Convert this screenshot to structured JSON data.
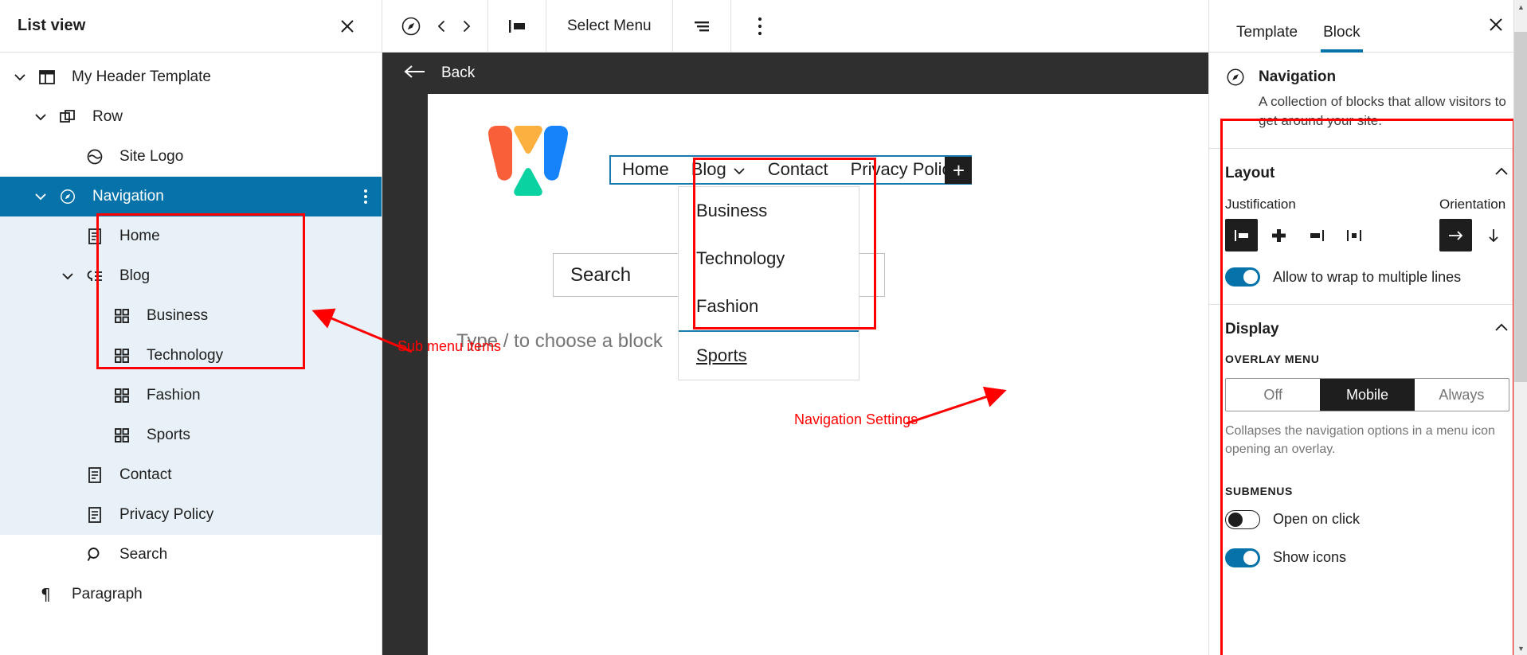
{
  "list_view": {
    "title": "List view",
    "close_icon": "close-icon",
    "items": [
      {
        "label": "My Header Template",
        "icon": "template-icon",
        "depth": 0,
        "expanded": true,
        "state": "normal"
      },
      {
        "label": "Row",
        "icon": "row-icon",
        "depth": 1,
        "expanded": true,
        "state": "normal"
      },
      {
        "label": "Site Logo",
        "icon": "site-logo-icon",
        "depth": 2,
        "expanded": null,
        "state": "normal"
      },
      {
        "label": "Navigation",
        "icon": "navigation-icon",
        "depth": 1,
        "expanded": true,
        "state": "selected"
      },
      {
        "label": "Home",
        "icon": "page-icon",
        "depth": 2,
        "expanded": null,
        "state": "child"
      },
      {
        "label": "Blog",
        "icon": "submenu-icon",
        "depth": 2,
        "expanded": true,
        "state": "child"
      },
      {
        "label": "Business",
        "icon": "grid-icon",
        "depth": 3,
        "expanded": null,
        "state": "child"
      },
      {
        "label": "Technology",
        "icon": "grid-icon",
        "depth": 3,
        "expanded": null,
        "state": "child"
      },
      {
        "label": "Fashion",
        "icon": "grid-icon",
        "depth": 3,
        "expanded": null,
        "state": "child"
      },
      {
        "label": "Sports",
        "icon": "grid-icon",
        "depth": 3,
        "expanded": null,
        "state": "child"
      },
      {
        "label": "Contact",
        "icon": "page-icon",
        "depth": 2,
        "expanded": null,
        "state": "child"
      },
      {
        "label": "Privacy Policy",
        "icon": "page-icon",
        "depth": 2,
        "expanded": null,
        "state": "child"
      },
      {
        "label": "Search",
        "icon": "search-icon",
        "depth": 2,
        "expanded": null,
        "state": "normal"
      },
      {
        "label": "Paragraph",
        "icon": "paragraph-icon",
        "depth": 0,
        "expanded": null,
        "state": "normal"
      }
    ]
  },
  "toolbar": {
    "navigation_icon": "compass-icon",
    "prev_label": "‹",
    "next_label": "›",
    "align_icon": "align-left-icon",
    "select_menu_label": "Select Menu",
    "list_icon": "justify-icon",
    "options_icon": "kebab-icon"
  },
  "canvas": {
    "back_label": "Back",
    "back_icon": "arrow-left-icon",
    "logo_alt": "site-logo",
    "nav": {
      "items": [
        {
          "label": "Home",
          "has_submenu": false
        },
        {
          "label": "Blog",
          "has_submenu": true
        },
        {
          "label": "Contact",
          "has_submenu": false
        },
        {
          "label": "Privacy Policy",
          "has_submenu": false
        }
      ],
      "add_block_label": "+"
    },
    "submenu": {
      "items": [
        {
          "label": "Business",
          "selected": false
        },
        {
          "label": "Technology",
          "selected": false
        },
        {
          "label": "Fashion",
          "selected": false
        },
        {
          "label": "Sports",
          "selected": true
        }
      ]
    },
    "search_label": "Search",
    "paragraph_placeholder": "Type / to choose a block"
  },
  "annotations": [
    {
      "label": "Sub menu items"
    },
    {
      "label": "Navigation Settings"
    }
  ],
  "settings": {
    "tabs": [
      {
        "label": "Template",
        "active": false
      },
      {
        "label": "Block",
        "active": true
      }
    ],
    "close_icon": "close-icon",
    "block": {
      "icon": "navigation-icon",
      "title": "Navigation",
      "description": "A collection of blocks that allow visitors to get around your site."
    },
    "layout": {
      "title": "Layout",
      "collapse_icon": "chevron-up-icon",
      "justification_label": "Justification",
      "orientation_label": "Orientation",
      "justification_options": [
        {
          "name": "justify-left",
          "active": true
        },
        {
          "name": "justify-center",
          "active": false
        },
        {
          "name": "justify-right",
          "active": false
        },
        {
          "name": "justify-space-between",
          "active": false
        }
      ],
      "orientation_options": [
        {
          "name": "orientation-horizontal",
          "active": true
        },
        {
          "name": "orientation-vertical",
          "active": false
        }
      ],
      "wrap_label": "Allow to wrap to multiple lines",
      "wrap_enabled": true
    },
    "display": {
      "title": "Display",
      "collapse_icon": "chevron-up-icon",
      "overlay_menu_label": "Overlay Menu",
      "overlay_options": [
        {
          "label": "Off",
          "active": false
        },
        {
          "label": "Mobile",
          "active": true
        },
        {
          "label": "Always",
          "active": false
        }
      ],
      "overlay_help": "Collapses the navigation options in a menu icon opening an overlay.",
      "submenus_label": "Submenus",
      "open_on_click_label": "Open on click",
      "open_on_click_enabled": false,
      "show_icons_label": "Show icons",
      "show_icons_enabled": true
    }
  },
  "colors": {
    "accent": "#0573aa",
    "selected_row": "#0573aa",
    "child_row_bg": "#e7f1f7",
    "annotation": "#ff0000",
    "canvas_bg": "#2f2f2f",
    "block_selected_border": "#1a7aad"
  }
}
